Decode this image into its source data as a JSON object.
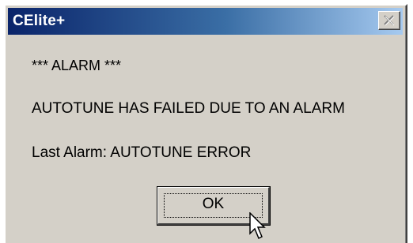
{
  "window": {
    "title": "CElite+",
    "close_icon": "close-x-icon"
  },
  "message": {
    "alarm_header": "*** ALARM ***",
    "main_text": "AUTOTUNE HAS FAILED DUE TO AN ALARM",
    "last_alarm": "Last Alarm:  AUTOTUNE ERROR"
  },
  "buttons": {
    "ok_label": "OK"
  },
  "pointer": {
    "icon": "arrow-cursor-icon"
  },
  "colors": {
    "title_start": "#0a246a",
    "title_end": "#a6caf0",
    "face": "#d4d0c8"
  }
}
